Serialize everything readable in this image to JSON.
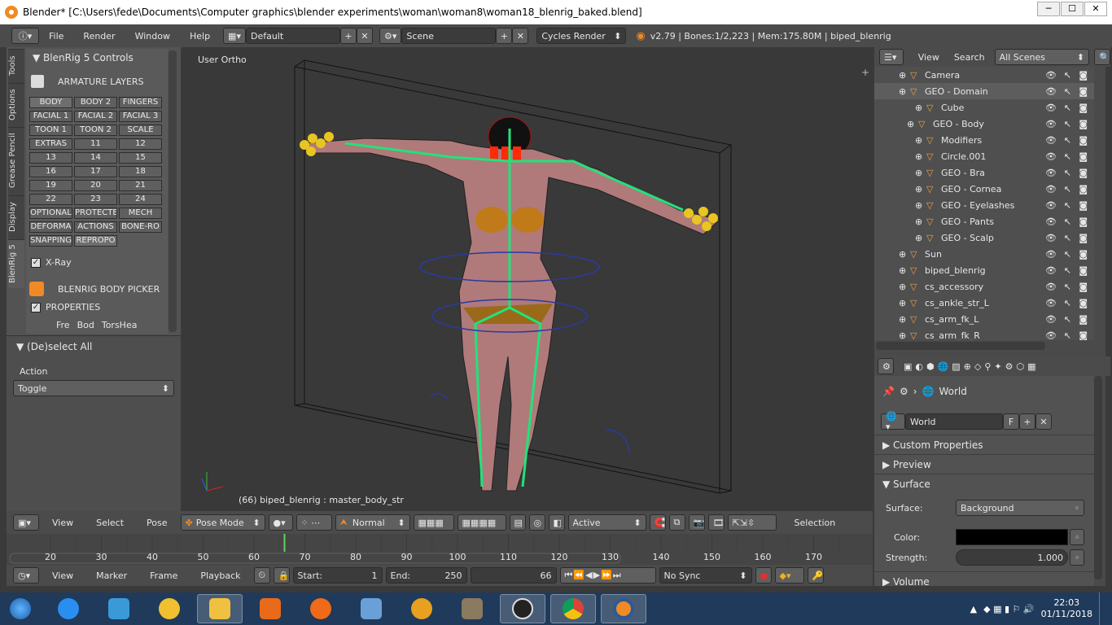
{
  "window": {
    "title": "Blender* [C:\\Users\\fede\\Documents\\Computer graphics\\blender experiments\\woman\\woman8\\woman18_blenrig_baked.blend]",
    "minimize": "─",
    "maximize": "☐",
    "close": "✕"
  },
  "menubar": {
    "items": [
      "File",
      "Render",
      "Window",
      "Help"
    ],
    "layout": "Default",
    "scene": "Scene",
    "engine": "Cycles Render",
    "status": "v2.79 | Bones:1/2,223 | Mem:175.80M | biped_blenrig"
  },
  "tool_tabs": [
    "Tools",
    "Options",
    "Grease Pencil",
    "Display",
    "BlenRig 5"
  ],
  "blenrig": {
    "title": "BlenRig 5 Controls",
    "armature_layers": "ARMATURE LAYERS",
    "layers": [
      "BODY",
      "BODY 2",
      "FINGERS",
      "FACIAL 1",
      "FACIAL 2",
      "FACIAL 3",
      "TOON 1",
      "TOON 2",
      "SCALE",
      "EXTRAS",
      "11",
      "12",
      "13",
      "14",
      "15",
      "16",
      "17",
      "18",
      "19",
      "20",
      "21",
      "22",
      "23",
      "24",
      "OPTIONAL",
      "PROTECTE",
      "MECH",
      "DEFORMA",
      "ACTIONS",
      "BONE-RO",
      "SNAPPING",
      "REPROPO"
    ],
    "xray": "X-Ray",
    "body_picker": "BLENRIG BODY PICKER",
    "properties": "PROPERTIES",
    "picker_tabs": [
      "Fre",
      "Bod",
      "TorsHea"
    ]
  },
  "operator": {
    "title": "(De)select All",
    "action_label": "Action",
    "action_value": "Toggle"
  },
  "viewport": {
    "view_label": "User Ortho",
    "active_info": "(66) biped_blenrig : master_body_str",
    "header": {
      "menus": [
        "View",
        "Select",
        "Pose"
      ],
      "mode": "Pose Mode",
      "orientation": "Normal",
      "pivot": "Active",
      "selection": "Selection"
    }
  },
  "timeline": {
    "ticks": [
      "20",
      "30",
      "40",
      "50",
      "60",
      "70",
      "80",
      "90",
      "100",
      "110",
      "120",
      "130",
      "140",
      "150",
      "160",
      "170"
    ],
    "current_frame": 66,
    "menus": [
      "View",
      "Marker",
      "Frame",
      "Playback"
    ],
    "start_label": "Start:",
    "start": "1",
    "end_label": "End:",
    "end": "250",
    "frame": "66",
    "sync": "No Sync"
  },
  "outliner": {
    "menus": [
      "View",
      "Search"
    ],
    "filter": "All Scenes",
    "rows": [
      {
        "label": "Camera",
        "indent": 2
      },
      {
        "label": "GEO - Domain",
        "indent": 2
      },
      {
        "label": "Cube",
        "indent": 4
      },
      {
        "label": "GEO - Body",
        "indent": 3
      },
      {
        "label": "Modifiers",
        "indent": 4
      },
      {
        "label": "Circle.001",
        "indent": 4
      },
      {
        "label": "GEO - Bra",
        "indent": 4
      },
      {
        "label": "GEO - Cornea",
        "indent": 4
      },
      {
        "label": "GEO - Eyelashes",
        "indent": 4
      },
      {
        "label": "GEO - Pants",
        "indent": 4
      },
      {
        "label": "GEO - Scalp",
        "indent": 4
      },
      {
        "label": "Sun",
        "indent": 2
      },
      {
        "label": "biped_blenrig",
        "indent": 2
      },
      {
        "label": "cs_accessory",
        "indent": 2
      },
      {
        "label": "cs_ankle_str_L",
        "indent": 2
      },
      {
        "label": "cs_arm_fk_L",
        "indent": 2
      },
      {
        "label": "cs_arm_fk_R",
        "indent": 2
      }
    ]
  },
  "properties": {
    "context": "World",
    "world_name": "World",
    "fake_user": "F",
    "sections": [
      "Custom Properties",
      "Preview",
      "Surface",
      "Volume"
    ],
    "surface_label": "Surface:",
    "surface_value": "Background",
    "color_label": "Color:",
    "color": "#000000",
    "strength_label": "Strength:",
    "strength": "1.000"
  },
  "taskbar": {
    "time": "22:03",
    "date": "01/11/2018",
    "apps": [
      "start-button",
      "internet-explorer",
      "media-player",
      "paint",
      "file-explorer",
      "office",
      "firefox",
      "photos",
      "helm-app",
      "gimp",
      "md-app",
      "chrome",
      "blender"
    ]
  }
}
